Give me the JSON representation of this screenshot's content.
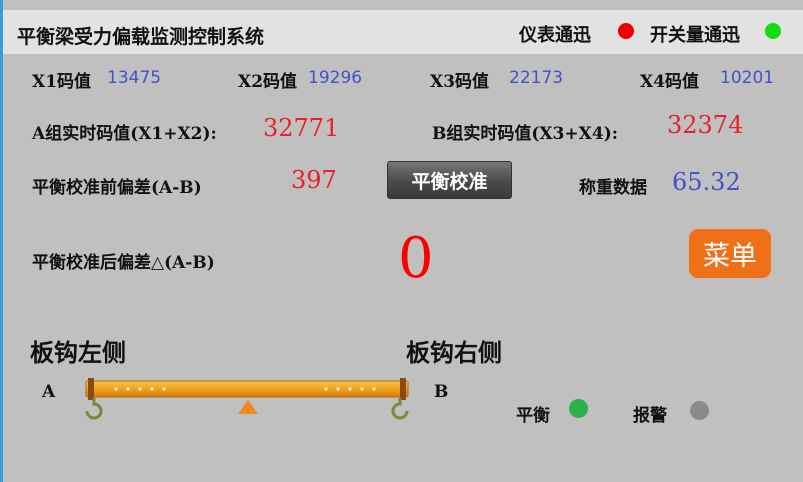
{
  "header": {
    "title": "平衡梁受力偏载监测控制系统",
    "instrument_comm_label": "仪表通迅",
    "switch_comm_label": "开关量通迅"
  },
  "codes": [
    {
      "label": "X1码值",
      "value": "13475"
    },
    {
      "label": "X2码值",
      "value": "19296"
    },
    {
      "label": "X3码值",
      "value": "22173"
    },
    {
      "label": "X4码值",
      "value": "10201"
    }
  ],
  "group_a": {
    "label": "A组实时码值(X1+X2):",
    "value": "32771"
  },
  "group_b": {
    "label": "B组实时码值(X3+X4):",
    "value": "32374"
  },
  "before_cal": {
    "label": "平衡校准前偏差(A-B)",
    "value": "397"
  },
  "cal_button_label": "平衡校准",
  "weigh": {
    "label": "称重数据",
    "value": "65.32"
  },
  "after_cal": {
    "label": "平衡校准后偏差△(A-B)",
    "value": "0"
  },
  "menu_button_label": "菜单",
  "hook_left": {
    "title": "板钩左侧",
    "mark": "A"
  },
  "hook_right": {
    "title": "板钩右侧",
    "mark": "B"
  },
  "indicators": {
    "balance_label": "平衡",
    "alarm_label": "报警"
  },
  "colors": {
    "instrument_comm": "#ee0000",
    "switch_comm": "#11dd11",
    "balance": "#27b34a",
    "alarm": "#8a8a8a",
    "accent_orange": "#f07018",
    "value_blue": "#4451c7",
    "value_red": "#e8202a"
  }
}
